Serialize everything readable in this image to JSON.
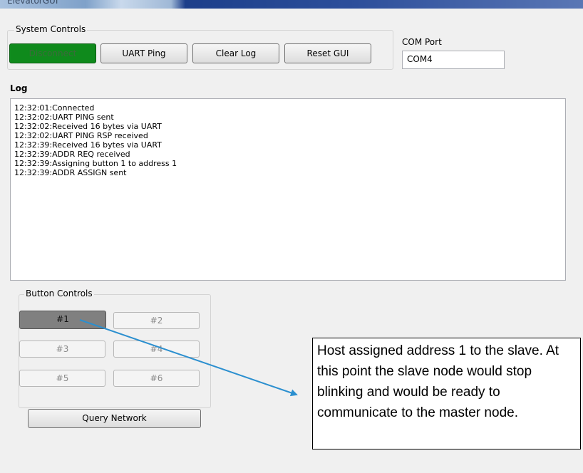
{
  "window": {
    "title": "ElevatorGUI"
  },
  "system_controls": {
    "title": "System Controls",
    "disconnect_label": "Disconnect",
    "uart_ping_label": "UART Ping",
    "clear_log_label": "Clear Log",
    "reset_gui_label": "Reset GUI"
  },
  "com_port": {
    "label": "COM Port",
    "value": "COM4"
  },
  "log": {
    "title": "Log",
    "lines": [
      "12:32:01:Connected",
      "12:32:02:UART PING sent",
      "12:32:02:Received 16 bytes via UART",
      "12:32:02:UART PING RSP received",
      "12:32:39:Received 16 bytes via UART",
      "12:32:39:ADDR REQ received",
      "12:32:39:Assigning button 1 to address 1",
      "12:32:39:ADDR ASSIGN sent"
    ]
  },
  "button_controls": {
    "title": "Button Controls",
    "buttons": [
      "#1",
      "#2",
      "#3",
      "#4",
      "#5",
      "#6"
    ],
    "query_label": "Query Network"
  },
  "annotation": {
    "text": "Host assigned address 1 to the slave. At this point the slave node would stop blinking and would be ready to communicate to the master node."
  },
  "colors": {
    "connected_green": "#0f8a1c",
    "selected_button": "#808080",
    "arrow": "#2b8fcf"
  }
}
